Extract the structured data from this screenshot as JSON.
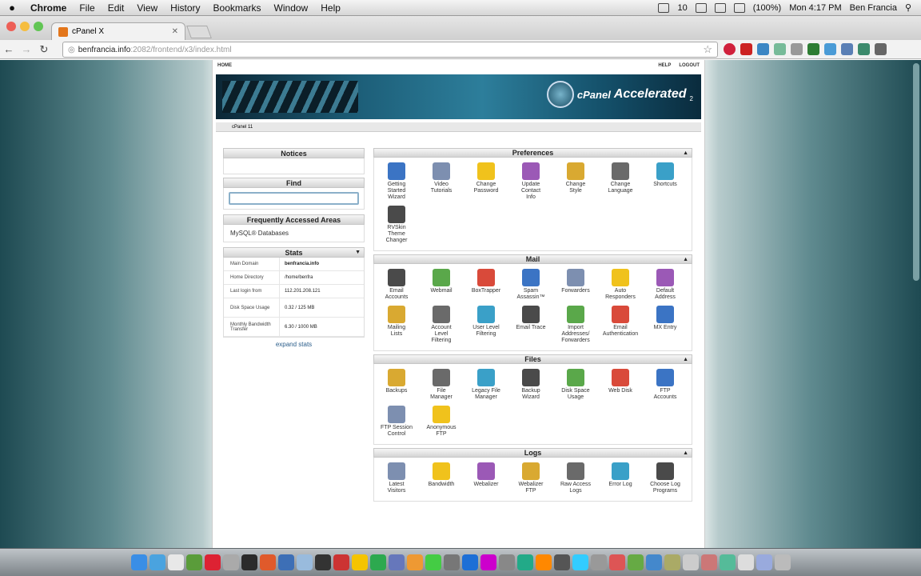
{
  "menubar": {
    "app": "Chrome",
    "items": [
      "File",
      "Edit",
      "View",
      "History",
      "Bookmarks",
      "Window",
      "Help"
    ],
    "battery": "(100%)",
    "clock": "Mon 4:17 PM",
    "user": "Ben Francia",
    "badge": "10"
  },
  "browser": {
    "tab_title": "cPanel X",
    "url_host": "benfrancia.info",
    "url_path": ":2082/frontend/x3/index.html"
  },
  "page": {
    "top_left": "HOME",
    "top_help": "HELP",
    "top_logout": "LOGOUT",
    "banner_cpanel": "cPanel",
    "banner_accelerated": "Accelerated",
    "banner_sub": "2",
    "crumb": "cPanel 11",
    "notices": "Notices",
    "find": "Find",
    "frequently": "Frequently Accessed Areas",
    "mysql": "MySQL® Databases",
    "stats": {
      "title": "Stats",
      "expand": "expand stats",
      "rows": [
        {
          "k": "Main Domain",
          "v": "benfrancia.info"
        },
        {
          "k": "Home Directory",
          "v": "/home/benfra"
        },
        {
          "k": "Last login from",
          "v": "112.201.208.121"
        },
        {
          "k": "Disk Space Usage",
          "v": "0.32 / 125 MB"
        },
        {
          "k": "Monthly Bandwidth Transfer",
          "v": "6.30 / 1000 MB"
        }
      ]
    },
    "panels": [
      {
        "title": "Preferences",
        "items": [
          "Getting\nStarted\nWizard",
          "Video\nTutorials",
          "Change\nPassword",
          "Update\nContact\nInfo",
          "Change\nStyle",
          "Change\nLanguage",
          "Shortcuts",
          "RVSkin\nTheme\nChanger"
        ]
      },
      {
        "title": "Mail",
        "items": [
          "Email\nAccounts",
          "Webmail",
          "BoxTrapper",
          "Spam\nAssassin™",
          "Forwarders",
          "Auto\nResponders",
          "Default\nAddress",
          "Mailing\nLists",
          "Account\nLevel\nFiltering",
          "User Level\nFiltering",
          "Email Trace",
          "Import\nAddresses/\nForwarders",
          "Email\nAuthentication",
          "MX Entry"
        ]
      },
      {
        "title": "Files",
        "items": [
          "Backups",
          "File\nManager",
          "Legacy File\nManager",
          "Backup\nWizard",
          "Disk Space\nUsage",
          "Web Disk",
          "FTP\nAccounts",
          "FTP Session\nControl",
          "Anonymous\nFTP"
        ]
      },
      {
        "title": "Logs",
        "items": [
          "Latest\nVisitors",
          "Bandwidth",
          "Webalizer",
          "Webalizer\nFTP",
          "Raw Access\nLogs",
          "Error Log",
          "Choose Log\nPrograms"
        ]
      }
    ]
  },
  "colors": {
    "icon_palette": [
      "#3b74c4",
      "#4a4a4a",
      "#d9a931",
      "#7d8fb0",
      "#5aa84a",
      "#6a6a6a",
      "#f0c21c",
      "#d94a3a",
      "#3aa0c8",
      "#9b59b6"
    ]
  }
}
